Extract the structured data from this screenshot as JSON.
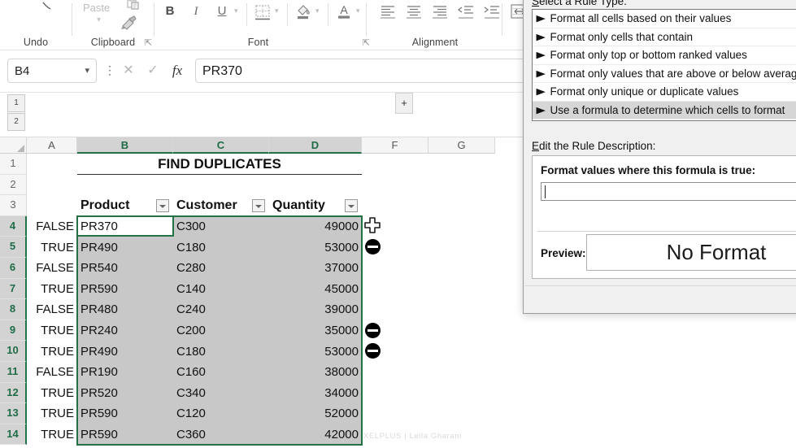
{
  "ribbon": {
    "groups": [
      {
        "label": "Undo"
      },
      {
        "label": "Clipboard"
      },
      {
        "label": "Font"
      },
      {
        "label": "Alignment"
      }
    ],
    "undo_label": "Undo",
    "clipboard_label": "Clipboard",
    "font_label": "Font",
    "alignment_label": "Alignment",
    "paste_label": "Paste",
    "font_buttons": [
      {
        "name": "bold-button",
        "glyph": "B"
      },
      {
        "name": "italic-button",
        "glyph": "I"
      },
      {
        "name": "underline-button",
        "glyph": "U"
      }
    ]
  },
  "formula_bar": {
    "name_box_value": "B4",
    "formula_value": "PR370",
    "cancel_icon": "✕",
    "enter_icon": "✓",
    "fx_icon": "fx"
  },
  "outline": {
    "level_1": "1",
    "level_2": "2",
    "expand_button": "+"
  },
  "grid": {
    "columns": [
      "A",
      "B",
      "C",
      "D",
      "F",
      "G"
    ],
    "rows": [
      "1",
      "2",
      "3",
      "4",
      "5",
      "6",
      "7",
      "8",
      "9",
      "10",
      "11",
      "12",
      "13",
      "14"
    ],
    "title_cell": "FIND DUPLICATES",
    "headers": {
      "product": "Product",
      "customer": "Customer",
      "quantity": "Quantity"
    },
    "data": [
      {
        "row": "4",
        "flag": "FALSE",
        "product": "PR370",
        "customer": "C300",
        "quantity": "49000",
        "dup": false
      },
      {
        "row": "5",
        "flag": "TRUE",
        "product": "PR490",
        "customer": "C180",
        "quantity": "53000",
        "dup": true
      },
      {
        "row": "6",
        "flag": "FALSE",
        "product": "PR540",
        "customer": "C280",
        "quantity": "37000",
        "dup": false
      },
      {
        "row": "7",
        "flag": "TRUE",
        "product": "PR590",
        "customer": "C140",
        "quantity": "45000",
        "dup": false
      },
      {
        "row": "8",
        "flag": "FALSE",
        "product": "PR480",
        "customer": "C240",
        "quantity": "39000",
        "dup": false
      },
      {
        "row": "9",
        "flag": "TRUE",
        "product": "PR240",
        "customer": "C200",
        "quantity": "35000",
        "dup": true
      },
      {
        "row": "10",
        "flag": "TRUE",
        "product": "PR490",
        "customer": "C180",
        "quantity": "53000",
        "dup": true
      },
      {
        "row": "11",
        "flag": "FALSE",
        "product": "PR190",
        "customer": "C160",
        "quantity": "38000",
        "dup": false
      },
      {
        "row": "12",
        "flag": "TRUE",
        "product": "PR520",
        "customer": "C340",
        "quantity": "34000",
        "dup": false
      },
      {
        "row": "13",
        "flag": "TRUE",
        "product": "PR590",
        "customer": "C120",
        "quantity": "52000",
        "dup": false
      },
      {
        "row": "14",
        "flag": "TRUE",
        "product": "PR590",
        "customer": "C360",
        "quantity": "42000",
        "dup": false
      }
    ],
    "watermark": "XELPLUS | Leila Gharani",
    "selection_accent": "#217346",
    "selection_fill": "#c8c8c8"
  },
  "dialog": {
    "rule_type_label": "Select a Rule Type:",
    "rule_types": [
      {
        "label": "Format all cells based on their values",
        "selected": false
      },
      {
        "label": "Format only cells that contain",
        "selected": false
      },
      {
        "label": "Format only top or bottom ranked values",
        "selected": false
      },
      {
        "label": "Format only values that are above or below average",
        "selected": false
      },
      {
        "label": "Format only unique or duplicate values",
        "selected": false
      },
      {
        "label": "Use a formula to determine which cells to format",
        "selected": true
      }
    ],
    "bullet": "▶",
    "edit_rule_label": "Edit the Rule Description:",
    "formula_prompt": "Format values where this formula is true:",
    "formula_value": "",
    "preview_label": "Preview:",
    "preview_text": "No Format"
  }
}
